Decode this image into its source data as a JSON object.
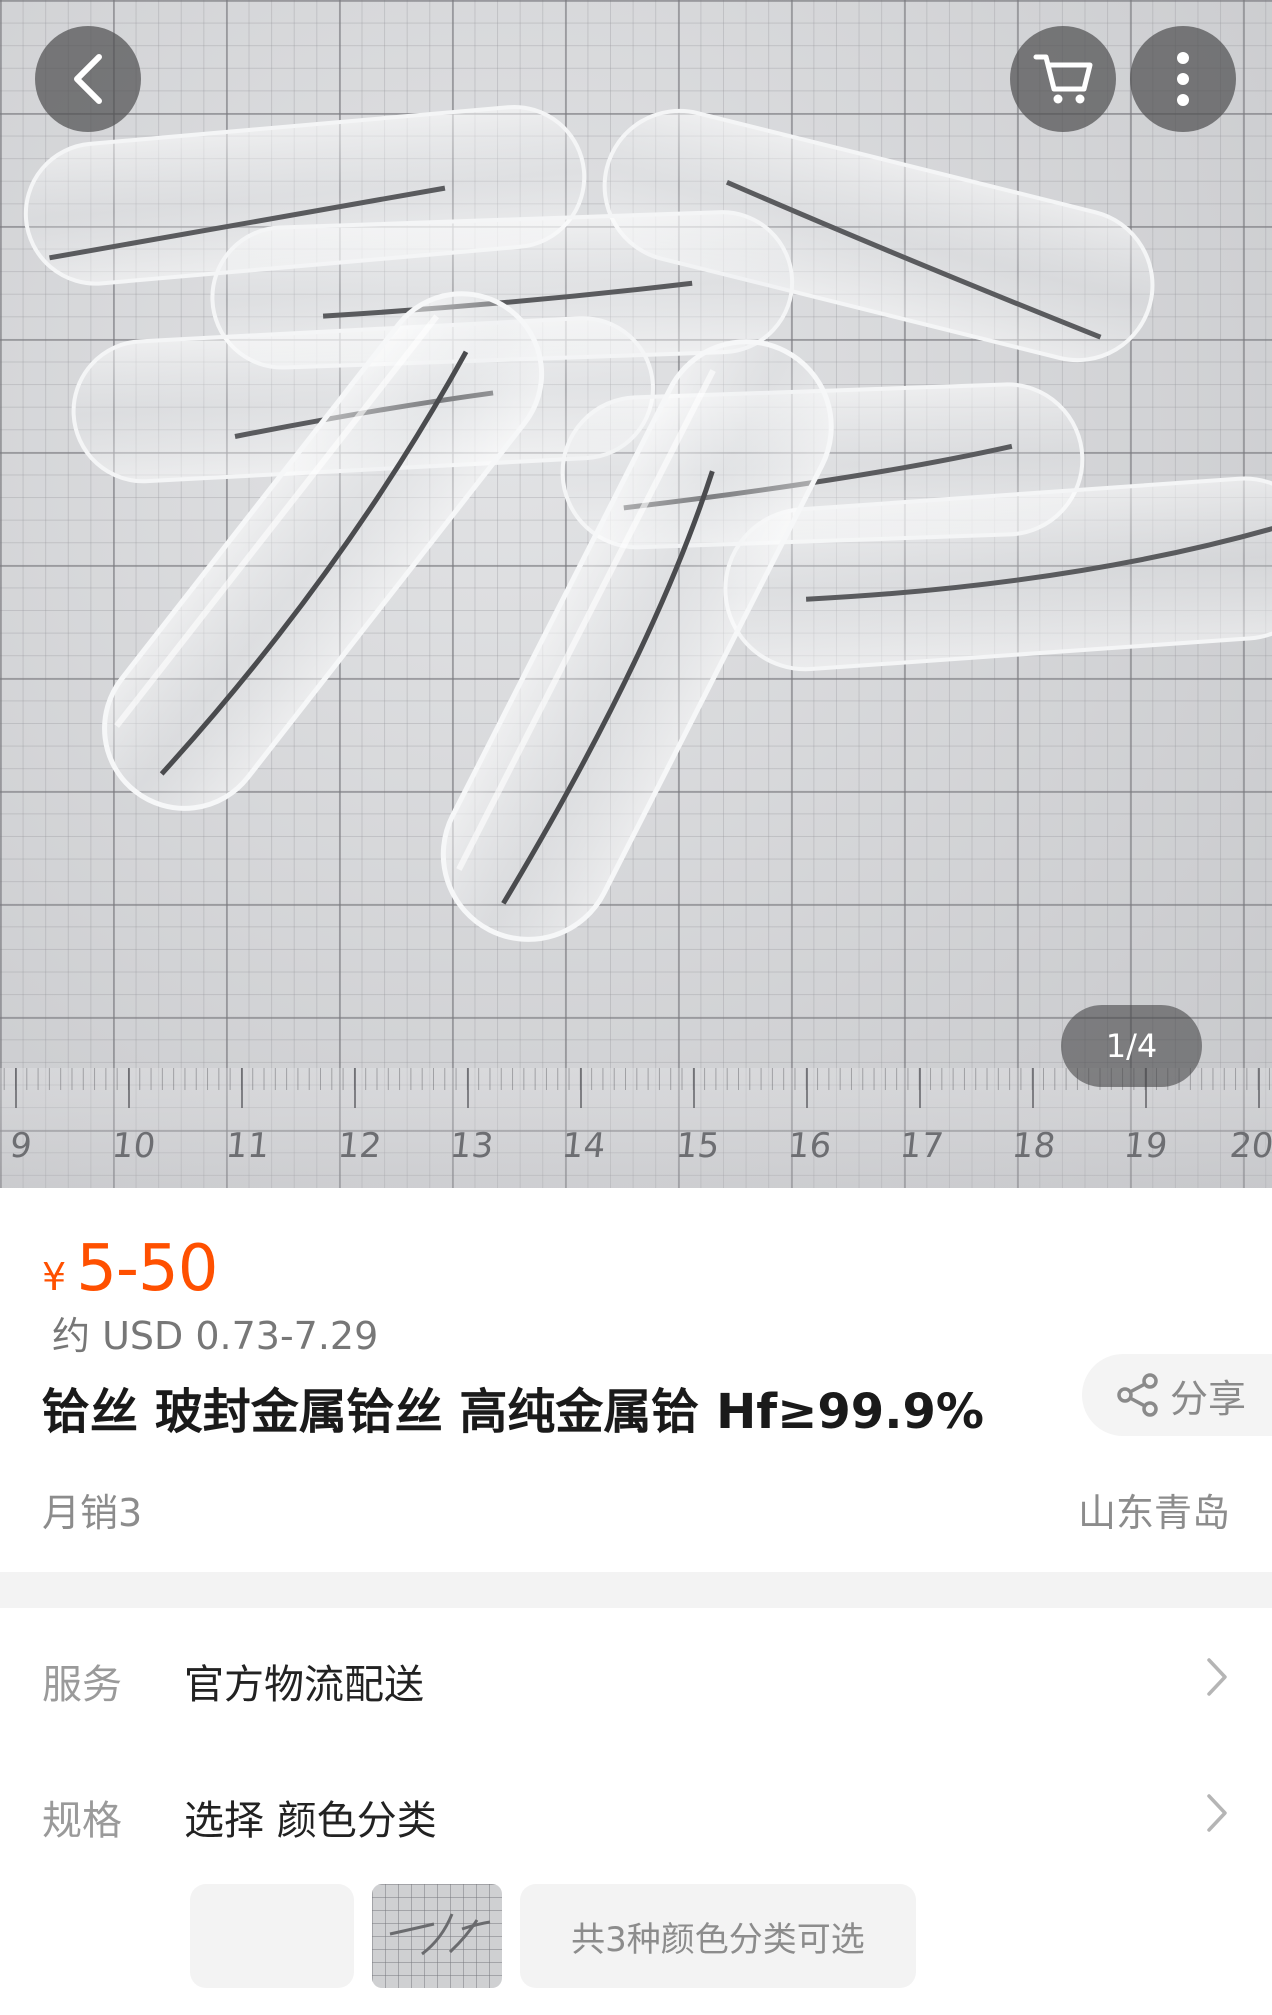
{
  "gallery": {
    "pager": "1/4",
    "ruler_labels": [
      "9",
      "10",
      "11",
      "12",
      "13",
      "14",
      "15",
      "16",
      "17",
      "18",
      "19",
      "20"
    ]
  },
  "nav": {
    "back_icon": "chevron-left-icon",
    "cart_icon": "cart-icon",
    "more_icon": "more-vertical-icon"
  },
  "product": {
    "currency_symbol": "¥",
    "price": "5-50",
    "usd_price": "约 USD 0.73-7.29",
    "title": "铪丝  玻封金属铪丝  高纯金属铪 Hf≥99.9%",
    "share_label": "分享",
    "monthly_sales": "月销3",
    "location": "山东青岛"
  },
  "service": {
    "label": "服务",
    "value": "官方物流配送"
  },
  "spec": {
    "label": "规格",
    "value": "选择 颜色分类",
    "options_note": "共3种颜色分类可选"
  },
  "colors": {
    "accent": "#ff5000",
    "muted_text": "#8c8c8c",
    "divider": "#f3f3f3"
  }
}
